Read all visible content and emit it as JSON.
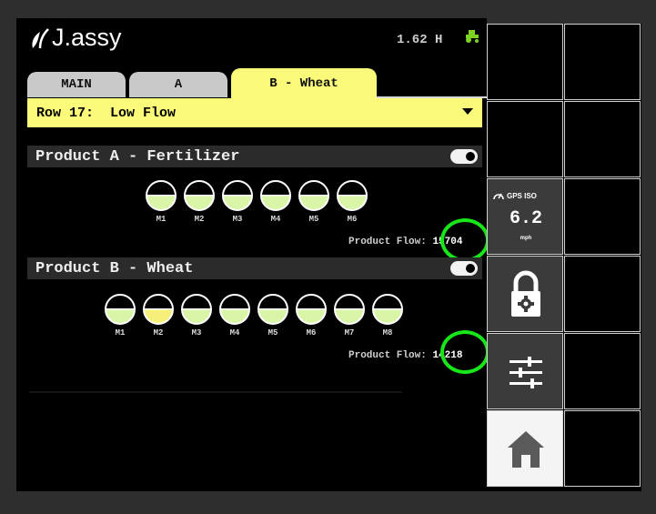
{
  "header": {
    "brand": "J.assy",
    "hours": "1.62 H",
    "tractor_icon": "tractor-icon"
  },
  "tabs": [
    {
      "label": "MAIN",
      "active": false
    },
    {
      "label": "A",
      "active": false
    },
    {
      "label": "B - Wheat",
      "active": true
    }
  ],
  "row_select": {
    "value": "Row 17:  Low Flow"
  },
  "product_a": {
    "title": "Product A - Fertilizer",
    "enabled": true,
    "meters": [
      {
        "label": "M1",
        "status": "normal"
      },
      {
        "label": "M2",
        "status": "normal"
      },
      {
        "label": "M3",
        "status": "normal"
      },
      {
        "label": "M4",
        "status": "normal"
      },
      {
        "label": "M5",
        "status": "normal"
      },
      {
        "label": "M6",
        "status": "normal"
      }
    ],
    "flow_label": "Product Flow:",
    "flow_value": "15704"
  },
  "product_b": {
    "title": "Product B - Wheat",
    "enabled": true,
    "meters": [
      {
        "label": "M1",
        "status": "normal"
      },
      {
        "label": "M2",
        "status": "low"
      },
      {
        "label": "M3",
        "status": "normal"
      },
      {
        "label": "M4",
        "status": "normal"
      },
      {
        "label": "M5",
        "status": "normal"
      },
      {
        "label": "M6",
        "status": "normal"
      },
      {
        "label": "M7",
        "status": "normal"
      },
      {
        "label": "M8",
        "status": "normal"
      }
    ],
    "flow_label": "Product Flow:",
    "flow_value": "14218"
  },
  "side_panel": {
    "gps": {
      "title": "GPS ISO",
      "speed": "6.2",
      "unit": "mph",
      "icon": "speedometer-icon"
    },
    "lock_icon": "lock-settings-icon",
    "sliders_icon": "sliders-icon",
    "home_icon": "home-icon"
  },
  "colors": {
    "accent_yellow": "#fbf97a",
    "meter_green": "#d9f5a8",
    "meter_yellow": "#f6f07a",
    "highlight_green": "#19e619"
  }
}
